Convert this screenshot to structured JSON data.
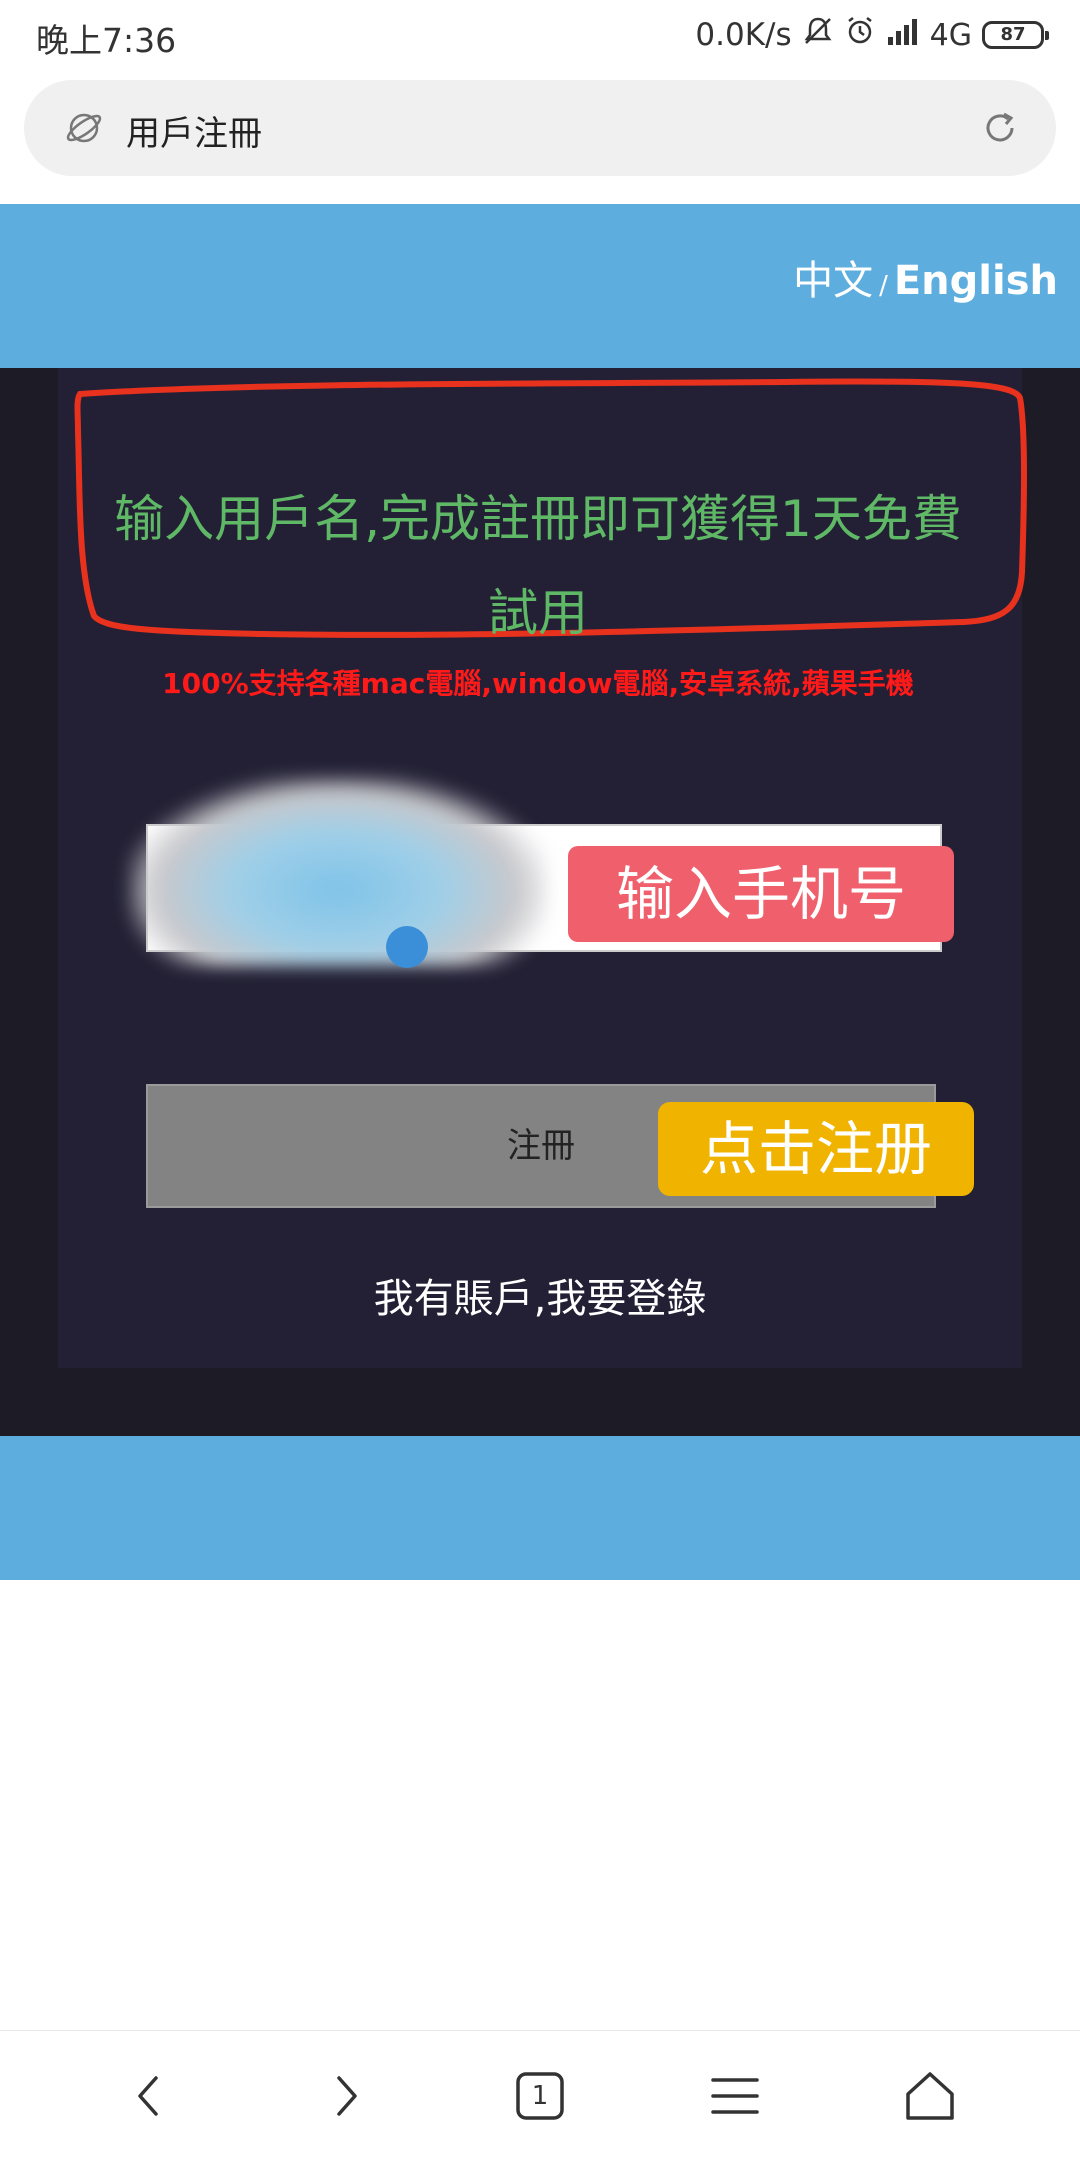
{
  "status_bar": {
    "time": "晚上7:36",
    "net_speed": "0.0K/s",
    "network": "4G",
    "battery": "87"
  },
  "address_bar": {
    "title": "用戶注冊"
  },
  "header": {
    "lang_zh": "中文",
    "lang_sep": "/",
    "lang_en": "English"
  },
  "main": {
    "promo": "输入用戶名,完成註冊即可獲得1天免費試用",
    "support": "100%支持各種mac電腦,window電腦,安卓系統,蘋果手機",
    "phone_tag": "输入手机号",
    "register_label": "注冊",
    "register_tag": "点击注册",
    "login_link": "我有賬戶,我要登錄"
  },
  "bottom_nav": {
    "tab_count": "1"
  },
  "colors": {
    "header_bg": "#5daede",
    "card_bg": "#232035",
    "promo_green": "#5fb865",
    "support_red": "#ff1a1a",
    "annotation_outline": "#e8321e",
    "phone_tag_bg": "#f0606c",
    "register_tag_bg": "#f0b400"
  }
}
